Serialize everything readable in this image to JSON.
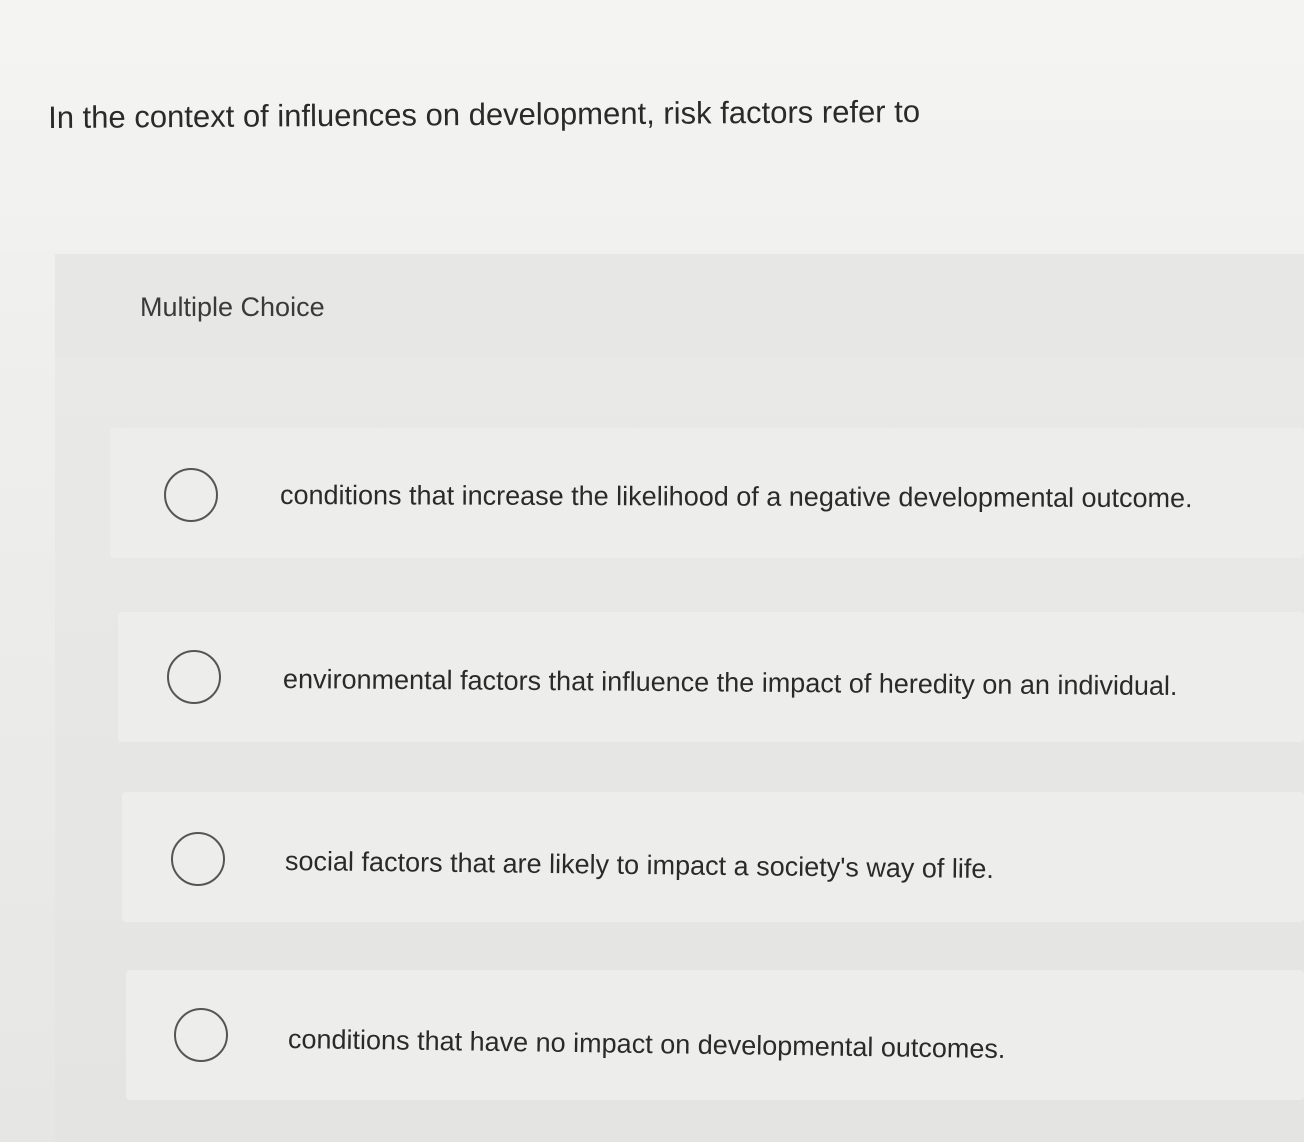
{
  "question": {
    "text": "In the context of influences on development, risk factors refer to"
  },
  "question_type": {
    "label": "Multiple Choice"
  },
  "options": [
    {
      "text": "conditions that increase the likelihood of a negative developmental outcome.",
      "selected": false
    },
    {
      "text": "environmental factors that influence the impact of heredity on an individual.",
      "selected": false
    },
    {
      "text": "social factors that are likely to impact a society's way of life.",
      "selected": false
    },
    {
      "text": "conditions that have no impact on developmental outcomes.",
      "selected": false
    }
  ]
}
